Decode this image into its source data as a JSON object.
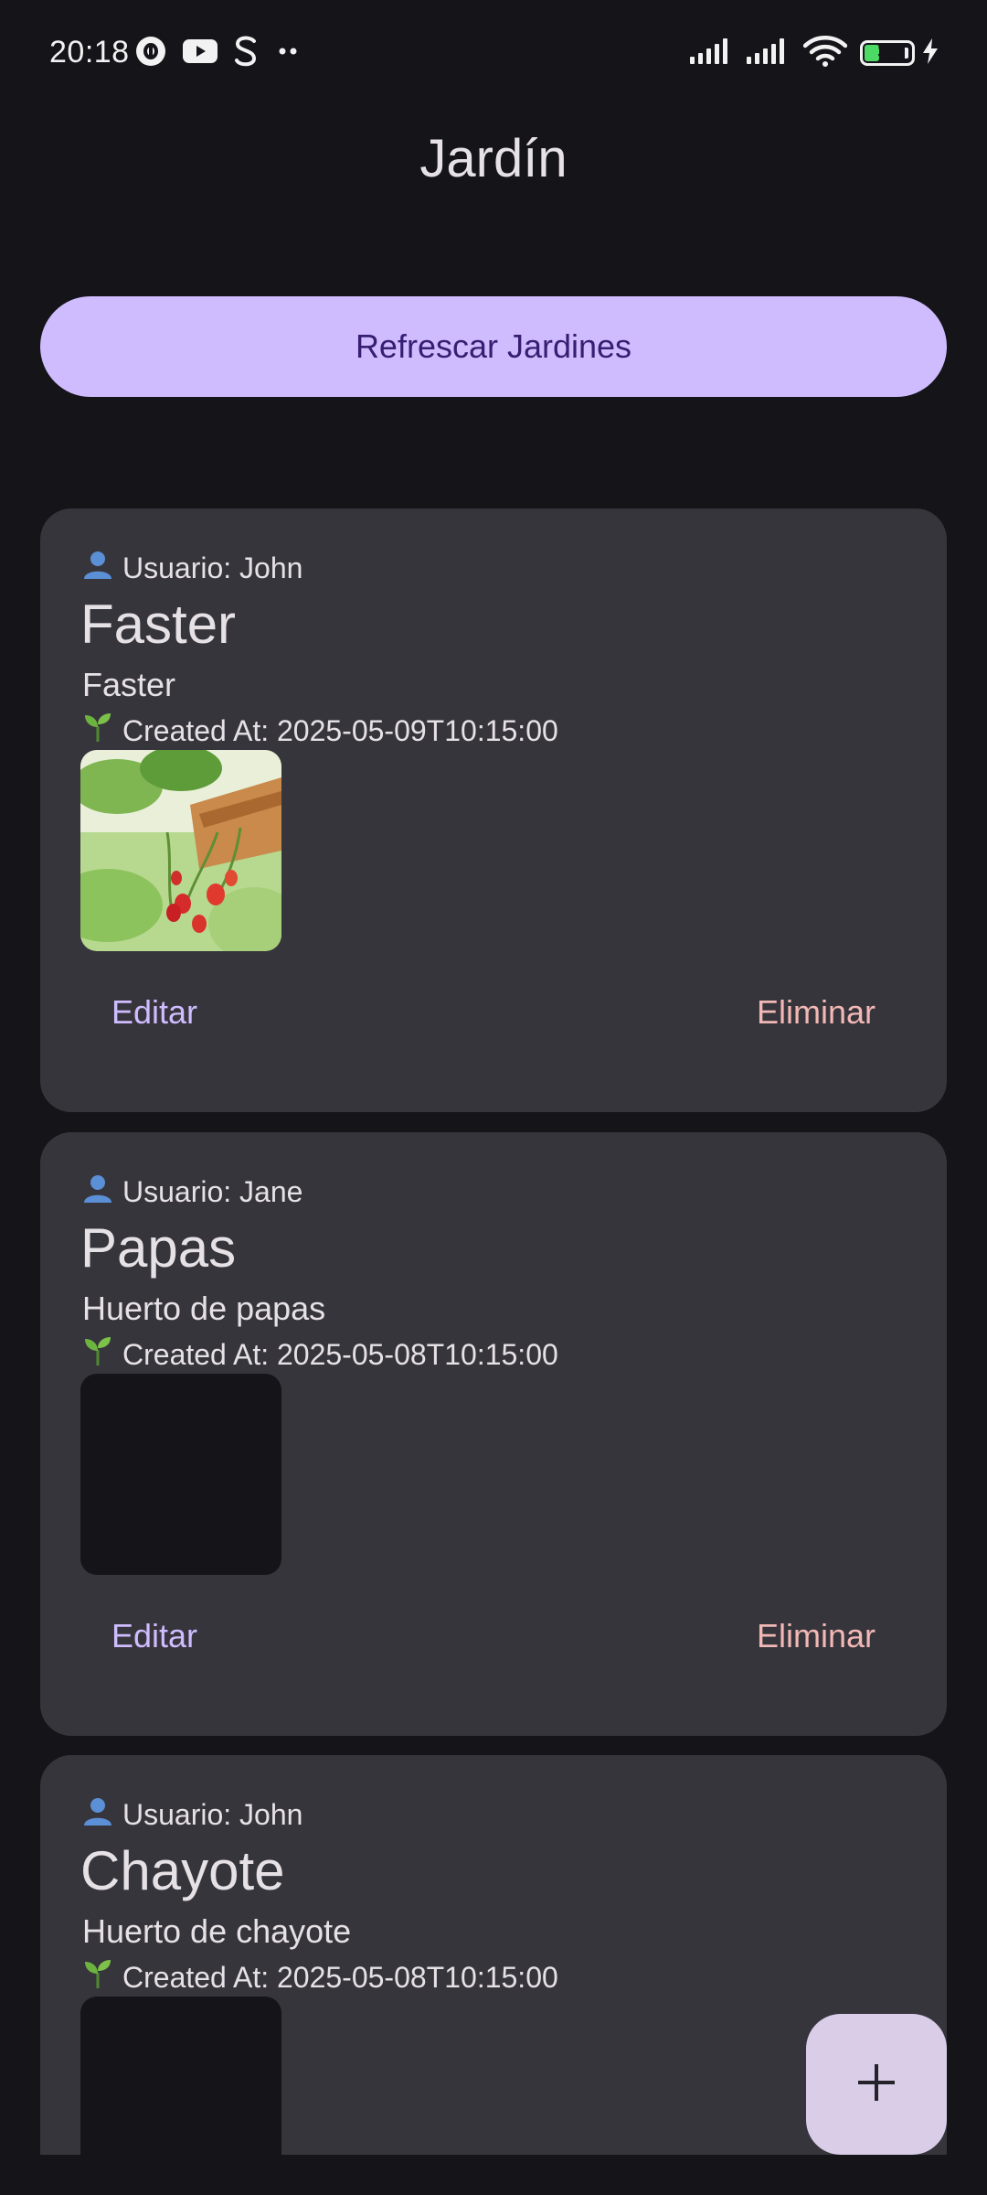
{
  "status_bar": {
    "time": "20:18",
    "battery_level": "30",
    "battery_fraction": 0.3,
    "icons": [
      "threads-icon",
      "youtube-icon",
      "s-icon",
      "more-dots-icon",
      "signal-icon",
      "signal-icon",
      "wifi-icon",
      "battery-icon",
      "charging-icon"
    ]
  },
  "app": {
    "title": "Jardín",
    "refresh_label": "Refrescar Jardines",
    "fab_icon": "plus-icon"
  },
  "gardens": [
    {
      "user": "Usuario: John",
      "title": "Faster",
      "description": "Faster",
      "created": "Created At: 2025-05-09T10:15:00",
      "image": "strawberry-plant",
      "edit_label": "Editar",
      "delete_label": "Eliminar"
    },
    {
      "user": "Usuario: Jane",
      "title": "Papas",
      "description": "Huerto de papas",
      "created": "Created At: 2025-05-08T10:15:00",
      "image": "empty",
      "edit_label": "Editar",
      "delete_label": "Eliminar"
    },
    {
      "user": "Usuario: John",
      "title": "Chayote",
      "description": "Huerto de chayote",
      "created": "Created At: 2025-05-08T10:15:00",
      "image": "empty"
    }
  ],
  "colors": {
    "background": "#151419",
    "card": "#37353C",
    "primary_button": "#CFBCFF",
    "primary_text": "#381E72",
    "edit": "#CFBCFF",
    "delete": "#F2B8B5",
    "fab": "#D9CDE7"
  }
}
